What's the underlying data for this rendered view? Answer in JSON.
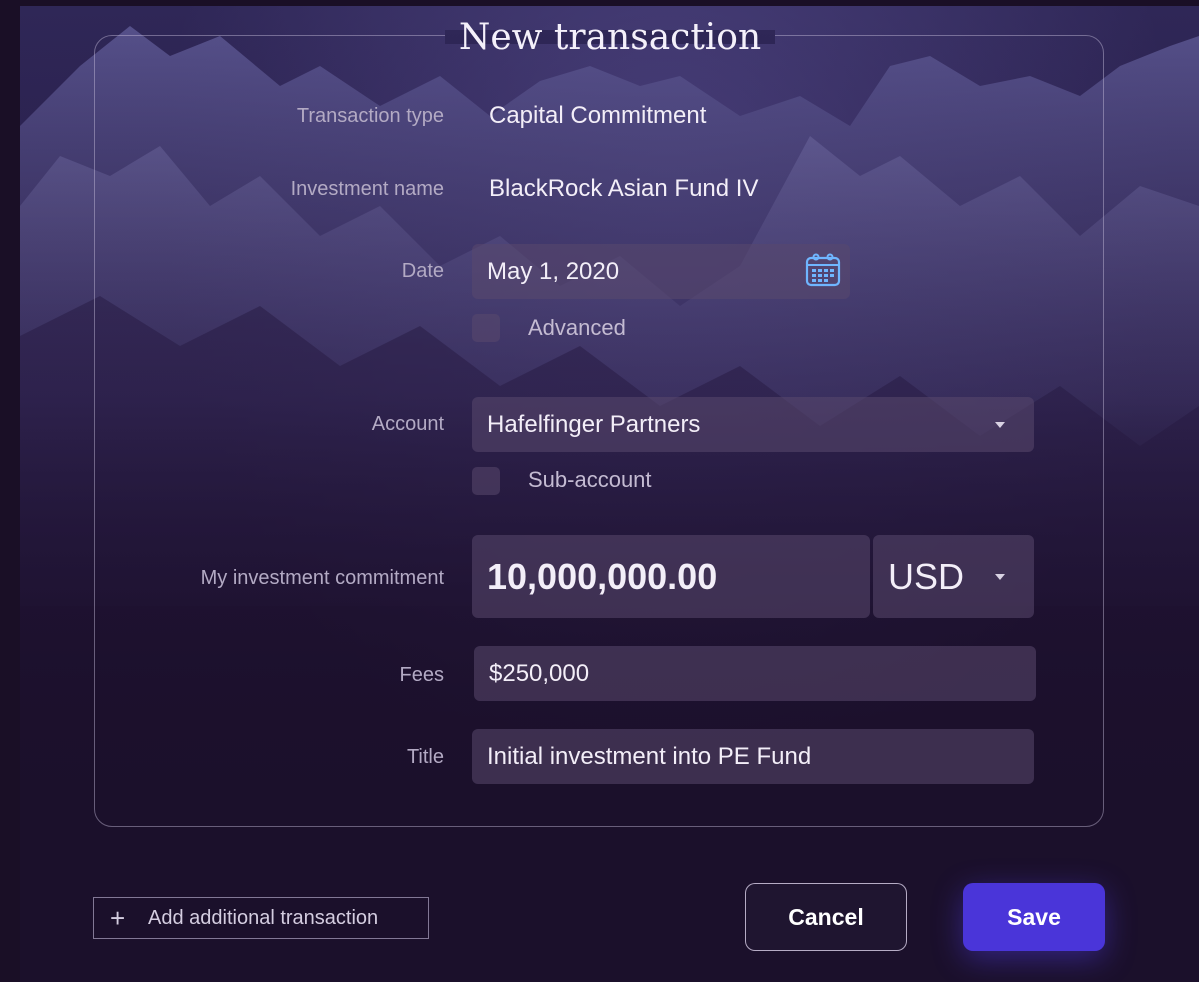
{
  "title": "New transaction",
  "fields": {
    "transaction_type": {
      "label": "Transaction type",
      "value": "Capital Commitment"
    },
    "investment_name": {
      "label": "Investment name",
      "value": "BlackRock Asian Fund IV"
    },
    "date": {
      "label": "Date",
      "value": "May 1, 2020"
    },
    "advanced": {
      "label": "Advanced",
      "checked": false
    },
    "account": {
      "label": "Account",
      "value": "Hafelfinger Partners"
    },
    "sub_account": {
      "label": "Sub-account",
      "checked": false
    },
    "commitment": {
      "label": "My investment commitment",
      "value": "10,000,000.00",
      "currency": "USD"
    },
    "fees": {
      "label": "Fees",
      "value": "$250,000"
    },
    "title_field": {
      "label": "Title",
      "value": "Initial investment into PE Fund"
    }
  },
  "actions": {
    "add_label": "Add additional transaction",
    "cancel_label": "Cancel",
    "save_label": "Save"
  },
  "icons": {
    "calendar": "calendar-icon",
    "dropdown": "chevron-down-icon",
    "add": "plus-icon"
  },
  "colors": {
    "primary": "#4a35d9",
    "calendar_icon": "#6fb6ff"
  }
}
